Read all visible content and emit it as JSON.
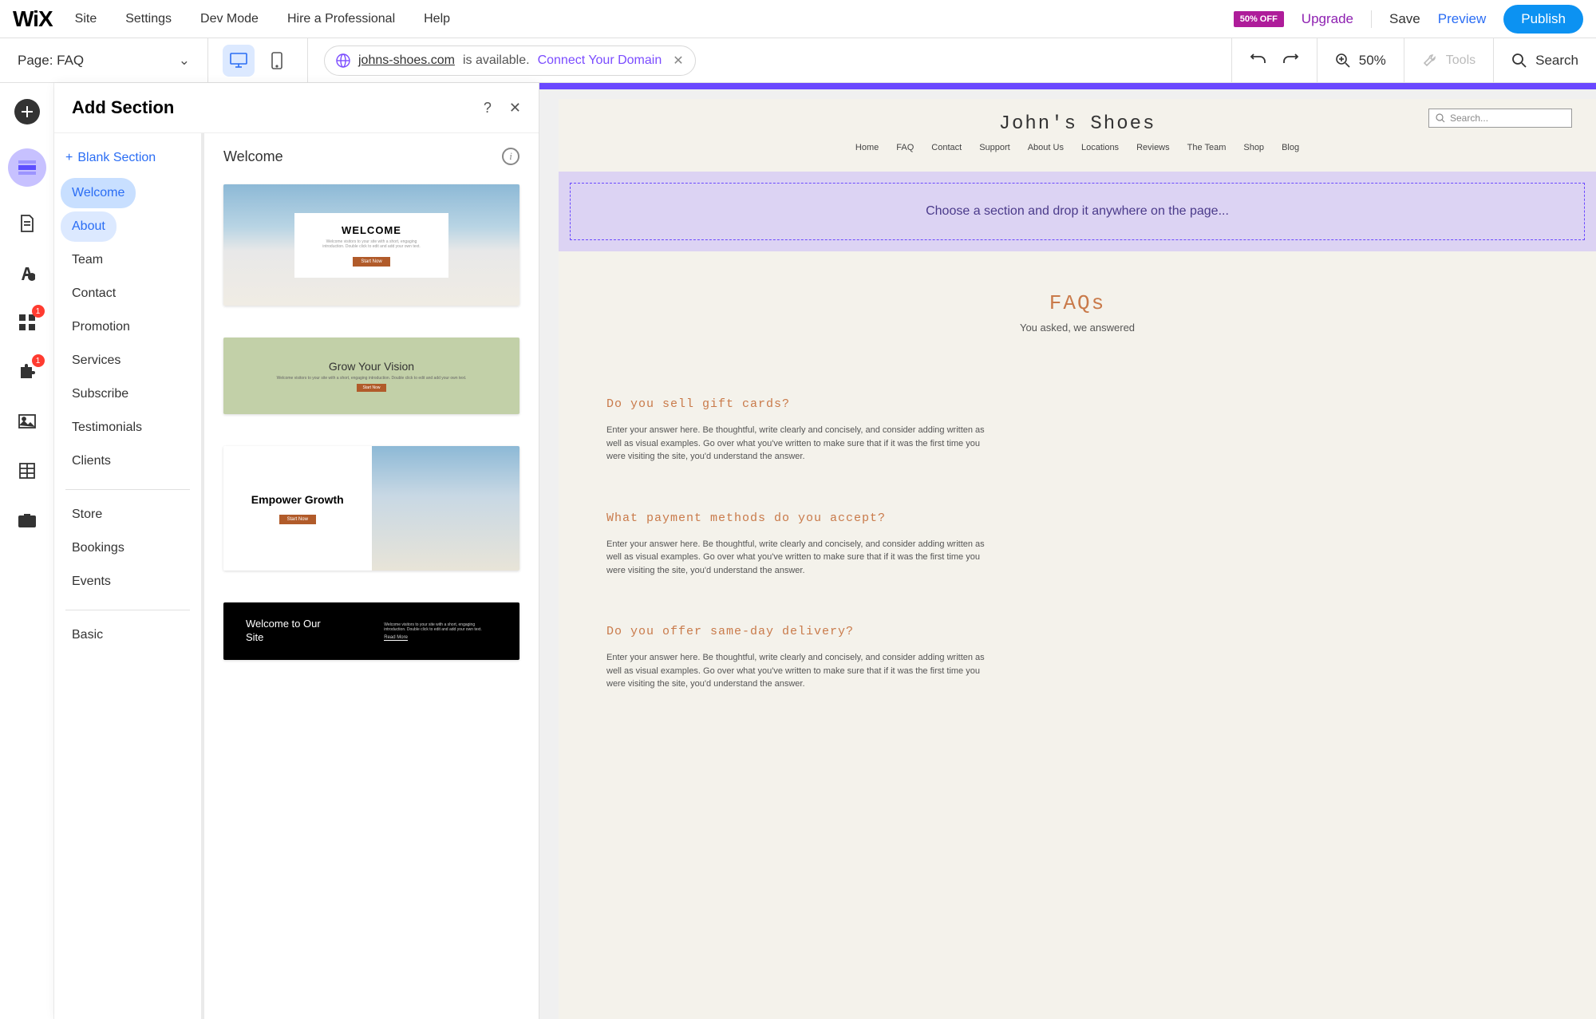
{
  "topbar": {
    "logo": "WiX",
    "nav": [
      "Site",
      "Settings",
      "Dev Mode",
      "Hire a Professional",
      "Help"
    ],
    "offer_badge": "50% OFF",
    "upgrade": "Upgrade",
    "save": "Save",
    "preview": "Preview",
    "publish": "Publish"
  },
  "secbar": {
    "page_label": "Page: FAQ",
    "domain": "johns-shoes.com",
    "available": "is available.",
    "connect": "Connect Your Domain",
    "zoom": "50%",
    "tools": "Tools",
    "search": "Search"
  },
  "leftrail": {
    "badges": {
      "apps": "1",
      "addons": "1"
    }
  },
  "panel": {
    "title": "Add Section",
    "blank": "Blank Section",
    "preview_heading": "Welcome",
    "categories": [
      "Welcome",
      "About",
      "Team",
      "Contact",
      "Promotion",
      "Services",
      "Subscribe",
      "Testimonials",
      "Clients"
    ],
    "categories2": [
      "Store",
      "Bookings",
      "Events"
    ],
    "categories3": [
      "Basic"
    ],
    "previews": {
      "p1": {
        "title": "WELCOME",
        "sub": "Welcome visitors to your site with a short, engaging introduction. Double click to edit and add your own text.",
        "btn": "Start Now"
      },
      "p2": {
        "title": "Grow Your Vision",
        "sub": "Welcome visitors to your site with a short, engaging introduction. Double click to edit and add your own text.",
        "btn": "Start Now"
      },
      "p3": {
        "title": "Empower Growth",
        "btn": "Start Now"
      },
      "p4": {
        "title": "Welcome to Our Site",
        "sub": "Welcome visitors to your site with a short, engaging introduction. Double click to edit and add your own text.",
        "btn": "Read More"
      }
    }
  },
  "site": {
    "title": "John's Shoes",
    "search_placeholder": "Search...",
    "nav": [
      "Home",
      "FAQ",
      "Contact",
      "Support",
      "About Us",
      "Locations",
      "Reviews",
      "The Team",
      "Shop",
      "Blog"
    ],
    "dropzone": "Choose a section and drop it anywhere on the page...",
    "faq_title": "FAQs",
    "faq_sub": "You asked, we answered",
    "faqs": [
      {
        "q": "Do you sell gift cards?",
        "a": "Enter your answer here. Be thoughtful, write clearly and concisely, and consider adding written as well as visual examples. Go over what you've written to make sure that if it was the first time you were visiting the site, you'd understand the answer."
      },
      {
        "q": "What payment methods do you accept?",
        "a": "Enter your answer here. Be thoughtful, write clearly and concisely, and consider adding written as well as visual examples. Go over what you've written to make sure that if it was the first time you were visiting the site, you'd understand the answer."
      },
      {
        "q": "Do you offer same-day delivery?",
        "a": "Enter your answer here. Be thoughtful, write clearly and concisely, and consider adding written as well as visual examples. Go over what you've written to make sure that if it was the first time you were visiting the site, you'd understand the answer."
      }
    ]
  }
}
